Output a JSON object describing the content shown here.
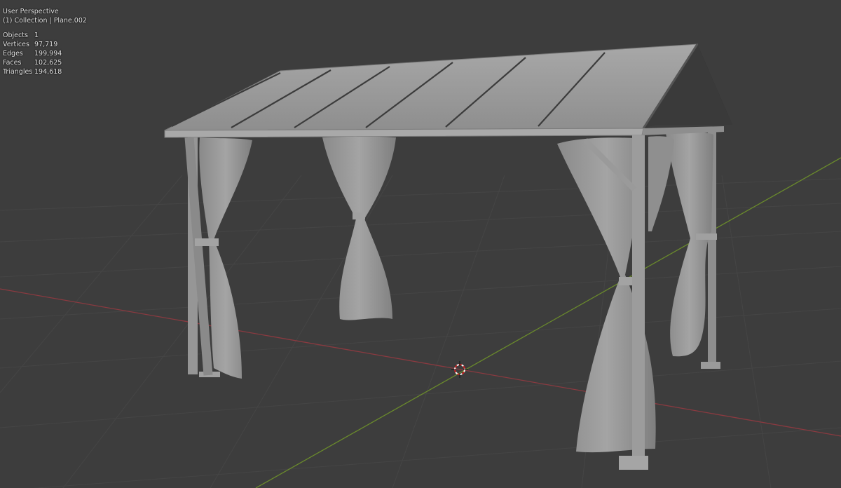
{
  "viewport": {
    "view_name": "User Perspective",
    "collection_label": "(1) Collection | Plane.002",
    "stats": [
      {
        "label": "Objects",
        "value": "1"
      },
      {
        "label": "Vertices",
        "value": "97,719"
      },
      {
        "label": "Edges",
        "value": "199,994"
      },
      {
        "label": "Faces",
        "value": "102,625"
      },
      {
        "label": "Triangles",
        "value": "194,618"
      }
    ],
    "colors": {
      "background": "#3d3d3d",
      "grid": "#464646",
      "x_axis": "#8a3a40",
      "y_axis": "#6a8a2c",
      "model": "#9a9a9a"
    },
    "scene_object": "gazebo-with-curtains"
  }
}
